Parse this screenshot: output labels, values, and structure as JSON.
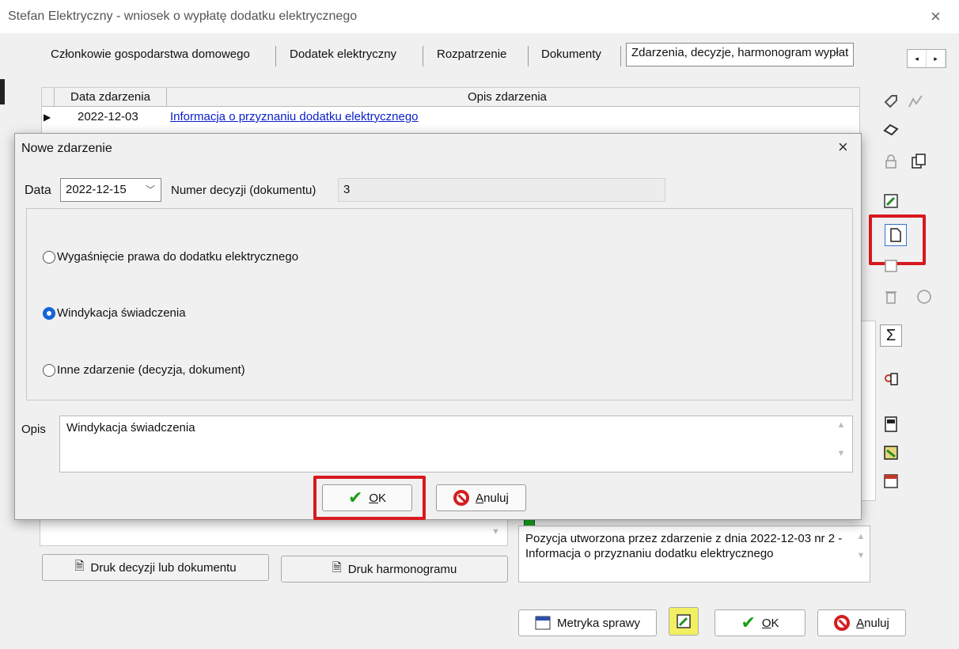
{
  "window": {
    "title": "Stefan Elektryczny - wniosek o wypłatę dodatku elektrycznego",
    "close": "×"
  },
  "tabs": [
    {
      "label": "Członkowie gospodarstwa domowego"
    },
    {
      "label": "Dodatek elektryczny"
    },
    {
      "label": "Rozpatrzenie"
    },
    {
      "label": "Dokumenty"
    },
    {
      "label": "Zdarzenia, decyzje, harmonogram wypłat"
    }
  ],
  "tab_scroll": {
    "left": "◂",
    "right": "▸"
  },
  "grid": {
    "headers": [
      "Data zdarzenia",
      "Opis zdarzenia"
    ],
    "rows": [
      {
        "indicator": "▶",
        "date": "2022-12-03",
        "description": "Informacja o przyznaniu dodatku elektrycznego"
      }
    ]
  },
  "toolbar": {
    "sigma": "Σ"
  },
  "bottom": {
    "print_decision": "Druk decyzji lub dokumentu",
    "print_schedule": "Druk harmonogramu",
    "note": "Pozycja utworzona przez zdarzenie z dnia 2022-12-03 nr 2 - Informacja o przyznaniu dodatku elektrycznego",
    "metryka": "Metryka sprawy",
    "ok": "OK",
    "cancel": "Anuluj"
  },
  "dialog": {
    "title": "Nowe zdarzenie",
    "close": "×",
    "date_label": "Data",
    "date_value": "2022-12-15",
    "number_label": "Numer decyzji (dokumentu)",
    "number_value": "3",
    "options": [
      {
        "label": "Wygaśnięcie prawa do dodatku elektrycznego",
        "selected": false
      },
      {
        "label": "Windykacja świadczenia",
        "selected": true
      },
      {
        "label": "Inne zdarzenie (decyzja, dokument)",
        "selected": false
      }
    ],
    "opis_label": "Opis",
    "opis_value": "Windykacja świadczenia",
    "ok": "OK",
    "cancel": "Anuluj"
  },
  "colors": {
    "highlight": "#d8191e",
    "link": "#0a1ecc",
    "accent": "#1565d8"
  }
}
